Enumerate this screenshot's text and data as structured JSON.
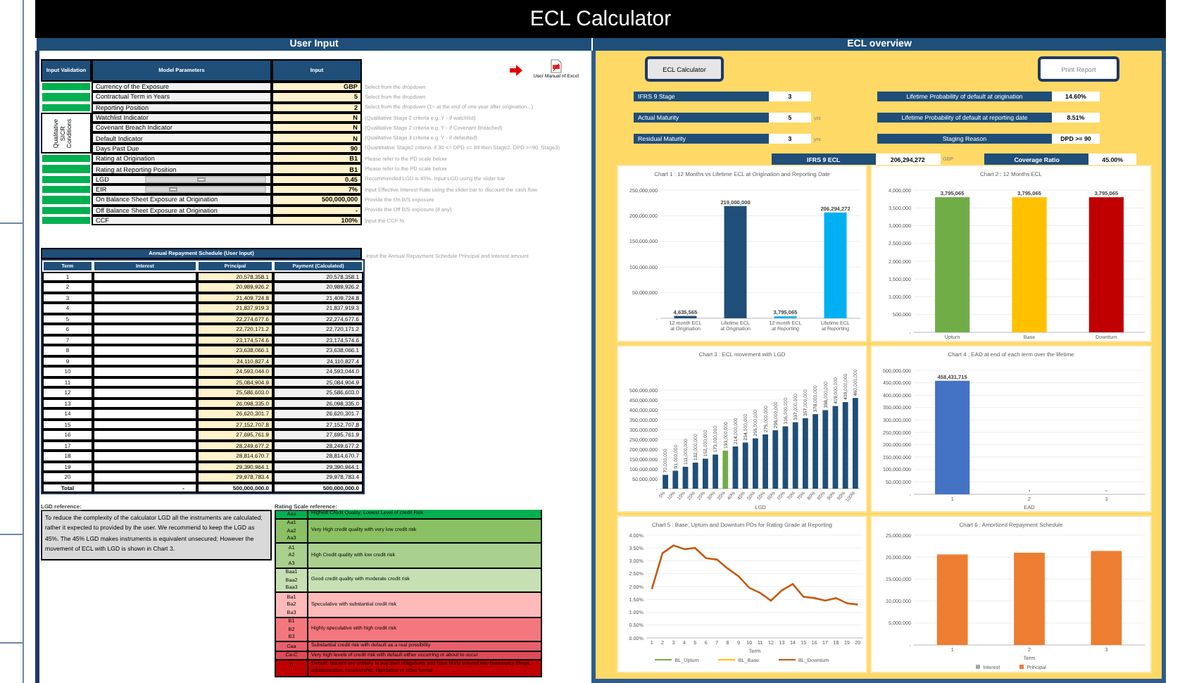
{
  "title": "ECL Calculator",
  "user_input": {
    "header": "User Input",
    "manual_link": "User Manual of Excel",
    "parameters_table": {
      "columns": [
        "Input Validation",
        "Model Parameters",
        "Input"
      ],
      "group_label": "Qualitative SICR Conditions",
      "rows": [
        {
          "parameter": "Currency of the Exposure",
          "input": "GBP",
          "hint": "Select from the dropdown",
          "valid": true,
          "grouped": false,
          "kind": "text"
        },
        {
          "parameter": "Contractual Term in Years",
          "input": "5",
          "hint": "Select from the dropdown",
          "valid": true,
          "grouped": false,
          "kind": "text"
        },
        {
          "parameter": "Reporting Position",
          "input": "2",
          "hint": "Select from the dropdown (1= at the end of one year after origination...)",
          "valid": true,
          "grouped": false,
          "kind": "text"
        },
        {
          "parameter": "Watchlist Indicator",
          "input": "N",
          "hint": "(Qualitative Stage 2 criteria e.g. Y - if watchlist)",
          "grouped": true,
          "kind": "text"
        },
        {
          "parameter": "Covenant Breach Indicator",
          "input": "N",
          "hint": "(Qualitative Stage 2 criteria e.g. Y - if Covenant Breached)",
          "grouped": true,
          "kind": "text"
        },
        {
          "parameter": "Default Indicator",
          "input": "N",
          "hint": "(Qualitative Stage 3 criteria e.g. Y - if defaulted)",
          "grouped": true,
          "kind": "text"
        },
        {
          "parameter": "Days Past Due",
          "input": "90",
          "hint": "(Quantitative Stage2 criteria. if 30 <= DPD <= 89 then Stage2, DPD >=90, Stage3)",
          "grouped": true,
          "kind": "text"
        },
        {
          "parameter": "Rating at Origination",
          "input": "B1",
          "hint": "Please refer to the PD scale below",
          "valid": true,
          "grouped": false,
          "kind": "text"
        },
        {
          "parameter": "Rating at Reporting Position",
          "input": "B1",
          "hint": "Please refer to the PD scale below",
          "valid": true,
          "grouped": false,
          "kind": "text"
        },
        {
          "parameter": "LGD",
          "input": "0.45",
          "hint": "Recommended LGD is 45%. Input LGD using the slider bar",
          "valid": true,
          "grouped": false,
          "kind": "slider",
          "level": 0.45
        },
        {
          "parameter": "EIR",
          "input": "7%",
          "hint": "Input Effective Interest Rate using the slider bar to discount the cash flow",
          "valid": true,
          "grouped": false,
          "kind": "slider",
          "level": 0.2
        },
        {
          "parameter": "On Balance Sheet Exposure at Origination",
          "input": "500,000,000",
          "hint": "Provide the On B/S exposure",
          "valid": true,
          "grouped": false,
          "kind": "text"
        },
        {
          "parameter": "Off Balance Sheet Exposure at Origination",
          "input": "-",
          "hint": "Provide the Off B/S exposure (if any)",
          "valid": true,
          "grouped": false,
          "kind": "text"
        },
        {
          "parameter": "CCF",
          "input": "100%",
          "hint": "Input the CCF %",
          "valid": true,
          "grouped": false,
          "kind": "text"
        }
      ]
    },
    "repayment_table": {
      "title": "Annual Repayment Schedule (User Input)",
      "hint": "Input the Annual Repayment Schedule Principal and Interest amount",
      "columns": [
        "Term",
        "Interest",
        "Principal",
        "Payment (Calculated)"
      ],
      "rows": [
        {
          "term": "1",
          "principal": "20,578,358.1",
          "payment": "20,578,358.1"
        },
        {
          "term": "2",
          "principal": "20,989,926.2",
          "payment": "20,989,926.2"
        },
        {
          "term": "3",
          "principal": "21,409,724.8",
          "payment": "21,409,724.8"
        },
        {
          "term": "4",
          "principal": "21,837,919.3",
          "payment": "21,837,919.3"
        },
        {
          "term": "5",
          "principal": "22,274,677.6",
          "payment": "22,274,677.6"
        },
        {
          "term": "6",
          "principal": "22,720,171.2",
          "payment": "22,720,171.2"
        },
        {
          "term": "7",
          "principal": "23,174,574.6",
          "payment": "23,174,574.6"
        },
        {
          "term": "8",
          "principal": "23,638,066.1",
          "payment": "23,638,066.1"
        },
        {
          "term": "9",
          "principal": "24,110,827.4",
          "payment": "24,110,827.4"
        },
        {
          "term": "10",
          "principal": "24,593,044.0",
          "payment": "24,593,044.0"
        },
        {
          "term": "11",
          "principal": "25,084,904.9",
          "payment": "25,084,904.9"
        },
        {
          "term": "12",
          "principal": "25,586,603.0",
          "payment": "25,586,603.0"
        },
        {
          "term": "13",
          "principal": "26,098,335.0",
          "payment": "26,098,335.0"
        },
        {
          "term": "14",
          "principal": "26,620,301.7",
          "payment": "26,620,301.7"
        },
        {
          "term": "15",
          "principal": "27,152,707.8",
          "payment": "27,152,707.8"
        },
        {
          "term": "16",
          "principal": "27,695,761.9",
          "payment": "27,695,761.9"
        },
        {
          "term": "17",
          "principal": "28,249,677.2",
          "payment": "28,249,677.2"
        },
        {
          "term": "18",
          "principal": "28,814,670.7",
          "payment": "28,814,670.7"
        },
        {
          "term": "19",
          "principal": "29,390,964.1",
          "payment": "29,390,964.1"
        },
        {
          "term": "20",
          "principal": "29,978,783.4",
          "payment": "29,978,783.4"
        }
      ],
      "total": {
        "label": "Total",
        "interest": "-",
        "principal": "500,000,000.0",
        "payment": "500,000,000.0"
      }
    },
    "lgd_reference": {
      "title": "LGD reference:",
      "text": "To reduce the complexity of the calculator LGD all the instruments are calculated; rather it expected to provided by the user. We recommend to keep the LGD as 45%. The 45% LGD makes instruments is equivalent unsecured; However the movement of ECL with LGD is shown in Chart 3."
    },
    "rating_scale": {
      "title": "Rating Scale reference:",
      "groups": [
        {
          "codes": [
            "Aaa"
          ],
          "description": "Highest Credit Quality; Lowest Level of credit Risk",
          "color": "#00b050"
        },
        {
          "codes": [
            "Aa1",
            "Aa2",
            "Aa3"
          ],
          "description": "Very High credit quality with very low credit risk",
          "color": "#8bc064"
        },
        {
          "codes": [
            "A1",
            "A2",
            "A3"
          ],
          "description": "High Credit quality with low credit risk",
          "color": "#a9d08e"
        },
        {
          "codes": [
            "Baa1",
            "Baa2",
            "Baa3"
          ],
          "description": "Good credit quality with moderate credit risk",
          "color": "#c6e0b4"
        },
        {
          "codes": [
            "Ba1",
            "Ba2",
            "Ba3"
          ],
          "description": "Speculative with substantial credit risk",
          "color": "#ffb9b9"
        },
        {
          "codes": [
            "B1",
            "B2",
            "B3"
          ],
          "description": "Highly speculative with high credit risk",
          "color": "#f4777e"
        },
        {
          "codes": [
            "Caa"
          ],
          "description": "Substantial credit risk with default as a real possibility",
          "color": "#e8606c"
        },
        {
          "codes": [
            "Ca-C"
          ],
          "description": "Very high levels of credit risk with default either occurring or about to occur",
          "color": "#e04a57"
        },
        {
          "codes": [
            "D"
          ],
          "description": "Default; Issuers are unlikely to pay their obligations and have likely entered into bankruptcy filings, administration, receivership, liquidation or other formal",
          "color": "#c00000"
        }
      ]
    }
  },
  "overview": {
    "header": "ECL overview",
    "buttons": [
      {
        "label": "ECL Calculator",
        "kind": "primary"
      },
      {
        "label": "Print Report",
        "kind": "plain"
      }
    ],
    "left_fields": [
      {
        "label": "IFRS 9 Stage",
        "value": "3"
      },
      {
        "label": "Actual Maturity",
        "value": "5",
        "unit": "yrs"
      },
      {
        "label": "Residual Maturity",
        "value": "3",
        "unit": "yrs"
      }
    ],
    "right_fields": [
      {
        "label": "Lifetime Probability of default at origination",
        "value": "14.60%"
      },
      {
        "label": "Lifetime Probability of default at reporting date",
        "value": "8.51%"
      },
      {
        "label": "Staging  Reason",
        "value": "DPD >= 90"
      }
    ],
    "ecl": {
      "label": "IFRS 9 ECL",
      "value": "206,294,272",
      "unit": "GBP"
    },
    "coverage": {
      "label": "Coverage Ratio",
      "value": "45.00%"
    },
    "charts": [
      {
        "chart_data": {
          "type": "bar",
          "title": "Chart 1 : 12 Months vs Lifetime ECL at Origination and Reporting Date",
          "grid": true,
          "categories": [
            "12 month ECL at Origination",
            "Lifetime ECL at Origination",
            "12 month ECL at Reporting",
            "Lifetime ECL at Reporting"
          ],
          "series": [
            {
              "colors": [
                "#1f4e79",
                "#1f4e79",
                "#00b0f0",
                "#00b0f0"
              ],
              "values": [
                4600000,
                219000000,
                3800000,
                206300000
              ]
            }
          ],
          "ylim": [
            0,
            250000000
          ],
          "yticks": [
            {
              "value": 0,
              "label": "-"
            },
            {
              "value": 50000000,
              "label": "50,000,000"
            },
            {
              "value": 100000000,
              "label": "100,000,000"
            },
            {
              "value": 150000000,
              "label": "150,000,000"
            },
            {
              "value": 200000000,
              "label": "200,000,000"
            },
            {
              "value": 250000000,
              "label": "250,000,000"
            }
          ],
          "value_labels": [
            "4,635,565",
            "219,000,000",
            "3,795,065",
            "206,294,272"
          ]
        }
      },
      {
        "chart_data": {
          "type": "bar",
          "title": "Chart 2 : 12 Months ECL",
          "grid": true,
          "categories": [
            "Upturn",
            "Base",
            "Downturn"
          ],
          "series": [
            {
              "colors": [
                "#70ad47",
                "#ffc000",
                "#c00000"
              ],
              "values": [
                3800000,
                3800000,
                3800000
              ]
            }
          ],
          "ylim": [
            0,
            4000000
          ],
          "yticks": [
            {
              "value": 0,
              "label": "-"
            },
            {
              "value": 500000,
              "label": "500,000"
            },
            {
              "value": 1000000,
              "label": "1,000,000"
            },
            {
              "value": 1500000,
              "label": "1,500,000"
            },
            {
              "value": 2000000,
              "label": "2,000,000"
            },
            {
              "value": 2500000,
              "label": "2,500,000"
            },
            {
              "value": 3000000,
              "label": "3,000,000"
            },
            {
              "value": 3500000,
              "label": "3,500,000"
            },
            {
              "value": 4000000,
              "label": "4,000,000"
            }
          ],
          "value_labels": [
            "3,795,065",
            "3,795,065",
            "3,795,065"
          ]
        }
      },
      {
        "chart_data": {
          "type": "bar",
          "title": "Chart 3 : ECL movement with LGD",
          "grid": true,
          "xlabel": "LGD",
          "categories": [
            "5%",
            "10%",
            "15%",
            "20%",
            "25%",
            "30%",
            "35%",
            "40%",
            "45%",
            "50%",
            "55%",
            "60%",
            "65%",
            "70%",
            "75%",
            "80%",
            "85%",
            "90%",
            "95%",
            "100%"
          ],
          "series": [
            {
              "colors": [
                "#1f4e79",
                "#1f4e79",
                "#1f4e79",
                "#1f4e79",
                "#1f4e79",
                "#1f4e79",
                "#70ad47",
                "#1f4e79",
                "#1f4e79",
                "#1f4e79",
                "#1f4e79",
                "#1f4e79",
                "#1f4e79",
                "#1f4e79",
                "#1f4e79",
                "#1f4e79",
                "#1f4e79",
                "#1f4e79",
                "#1f4e79",
                "#1f4e79"
              ],
              "values": [
                70000000,
                91000000,
                111000000,
                132000000,
                152000000,
                173000000,
                193000000,
                214000000,
                234000000,
                255000000,
                275000000,
                296000000,
                316000000,
                337000000,
                357000000,
                378000000,
                398000000,
                419000000,
                439000000,
                460000000
              ]
            }
          ],
          "ylim": [
            0,
            500000000
          ],
          "yticks": [
            {
              "value": 0,
              "label": "-"
            },
            {
              "value": 50000000,
              "label": "50,000,000"
            },
            {
              "value": 100000000,
              "label": "100,000,000"
            },
            {
              "value": 150000000,
              "label": "150,000,000"
            },
            {
              "value": 200000000,
              "label": "200,000,000"
            },
            {
              "value": 250000000,
              "label": "250,000,000"
            },
            {
              "value": 300000000,
              "label": "300,000,000"
            },
            {
              "value": 350000000,
              "label": "350,000,000"
            },
            {
              "value": 400000000,
              "label": "400,000,000"
            },
            {
              "value": 450000000,
              "label": "450,000,000"
            },
            {
              "value": 500000000,
              "label": "500,000,000"
            }
          ],
          "value_labels": [
            "70,000,000",
            "91,000,000",
            "111,000,000",
            "132,000,000",
            "152,000,000",
            "173,000,000",
            "193,000,000",
            "214,000,000",
            "234,000,000",
            "255,000,000",
            "275,000,000",
            "296,000,000",
            "316,000,000",
            "337,000,000",
            "357,000,000",
            "378,000,000",
            "398,000,000",
            "419,000,000",
            "439,000,000",
            "460,000,000"
          ]
        }
      },
      {
        "chart_data": {
          "type": "bar",
          "title": "Chart 4 : EAD at end of each term over the lifetime",
          "grid": true,
          "xlabel": "EAD",
          "categories": [
            "1",
            "2",
            "3"
          ],
          "series": [
            {
              "color": "#4472c4",
              "values": [
                458000000,
                0,
                0
              ]
            }
          ],
          "ylim": [
            0,
            500000000
          ],
          "yticks": [
            {
              "value": 0,
              "label": "-"
            },
            {
              "value": 50000000,
              "label": "50,000,000"
            },
            {
              "value": 100000000,
              "label": "100,000,000"
            },
            {
              "value": 150000000,
              "label": "150,000,000"
            },
            {
              "value": 200000000,
              "label": "200,000,000"
            },
            {
              "value": 250000000,
              "label": "250,000,000"
            },
            {
              "value": 300000000,
              "label": "300,000,000"
            },
            {
              "value": 350000000,
              "label": "350,000,000"
            },
            {
              "value": 400000000,
              "label": "400,000,000"
            },
            {
              "value": 450000000,
              "label": "450,000,000"
            },
            {
              "value": 500000000,
              "label": "500,000,000"
            }
          ],
          "value_labels": [
            "458,431,715",
            "-",
            "-"
          ]
        }
      },
      {
        "chart_data": {
          "type": "line",
          "title": "Chart 5 : Base, Upturn and Downturn PDs for Rating Grade at Reporting",
          "grid": true,
          "legend": "bottom",
          "xlabel": "Term",
          "x": [
            1,
            2,
            3,
            4,
            5,
            6,
            7,
            8,
            9,
            10,
            11,
            12,
            13,
            14,
            15,
            16,
            17,
            18,
            19,
            20
          ],
          "xlim": [
            0.5,
            20.5
          ],
          "xticks": [
            1,
            2,
            3,
            4,
            5,
            6,
            7,
            8,
            9,
            10,
            11,
            12,
            13,
            14,
            15,
            16,
            17,
            18,
            19,
            20
          ],
          "series": [
            {
              "name": "BL_Upturn",
              "color": "#70ad47",
              "values": [
                null,
                null,
                null,
                null,
                null,
                null,
                null,
                null,
                null,
                null,
                null,
                null,
                null,
                null,
                null,
                null,
                null,
                null,
                null,
                null
              ]
            },
            {
              "name": "BL_Base",
              "color": "#ffc000",
              "values": [
                null,
                null,
                null,
                null,
                null,
                null,
                null,
                null,
                null,
                null,
                null,
                null,
                null,
                null,
                null,
                null,
                null,
                null,
                null,
                null
              ]
            },
            {
              "name": "BL_Downturn",
              "color": "#c55a11",
              "values": [
                0.019,
                0.033,
                0.036,
                0.0345,
                0.035,
                0.031,
                0.0305,
                0.027,
                0.024,
                0.0195,
                0.0175,
                0.0145,
                0.0185,
                0.021,
                0.016,
                0.0155,
                0.0145,
                0.0155,
                0.0135,
                0.013
              ]
            }
          ],
          "ylim": [
            0,
            0.04
          ],
          "yticks": [
            {
              "value": 0,
              "label": "0.00%"
            },
            {
              "value": 0.005,
              "label": "0.50%"
            },
            {
              "value": 0.01,
              "label": "1.00%"
            },
            {
              "value": 0.015,
              "label": "1.50%"
            },
            {
              "value": 0.02,
              "label": "2.00%"
            },
            {
              "value": 0.025,
              "label": "2.50%"
            },
            {
              "value": 0.03,
              "label": "3.00%"
            },
            {
              "value": 0.035,
              "label": "3.50%"
            },
            {
              "value": 0.04,
              "label": "4.00%"
            }
          ]
        }
      },
      {
        "chart_data": {
          "type": "bar",
          "title": "Chart 6 : Amortized Repayment Schedule",
          "grid": true,
          "legend": "bottom",
          "xlabel": "Term",
          "categories": [
            "1",
            "2",
            "3"
          ],
          "stacked": true,
          "series": [
            {
              "name": "Interest",
              "color": "#a5a5a5",
              "values": [
                0,
                0,
                0
              ]
            },
            {
              "name": "Principal",
              "color": "#ed7d31",
              "values": [
                20600000,
                21000000,
                21400000
              ]
            }
          ],
          "ylim": [
            0,
            25000000
          ],
          "yticks": [
            {
              "value": 0,
              "label": "-"
            },
            {
              "value": 5000000,
              "label": "5,000,000"
            },
            {
              "value": 10000000,
              "label": "10,000,000"
            },
            {
              "value": 15000000,
              "label": "15,000,000"
            },
            {
              "value": 20000000,
              "label": "20,000,000"
            },
            {
              "value": 25000000,
              "label": "25,000,000"
            }
          ]
        }
      }
    ]
  }
}
